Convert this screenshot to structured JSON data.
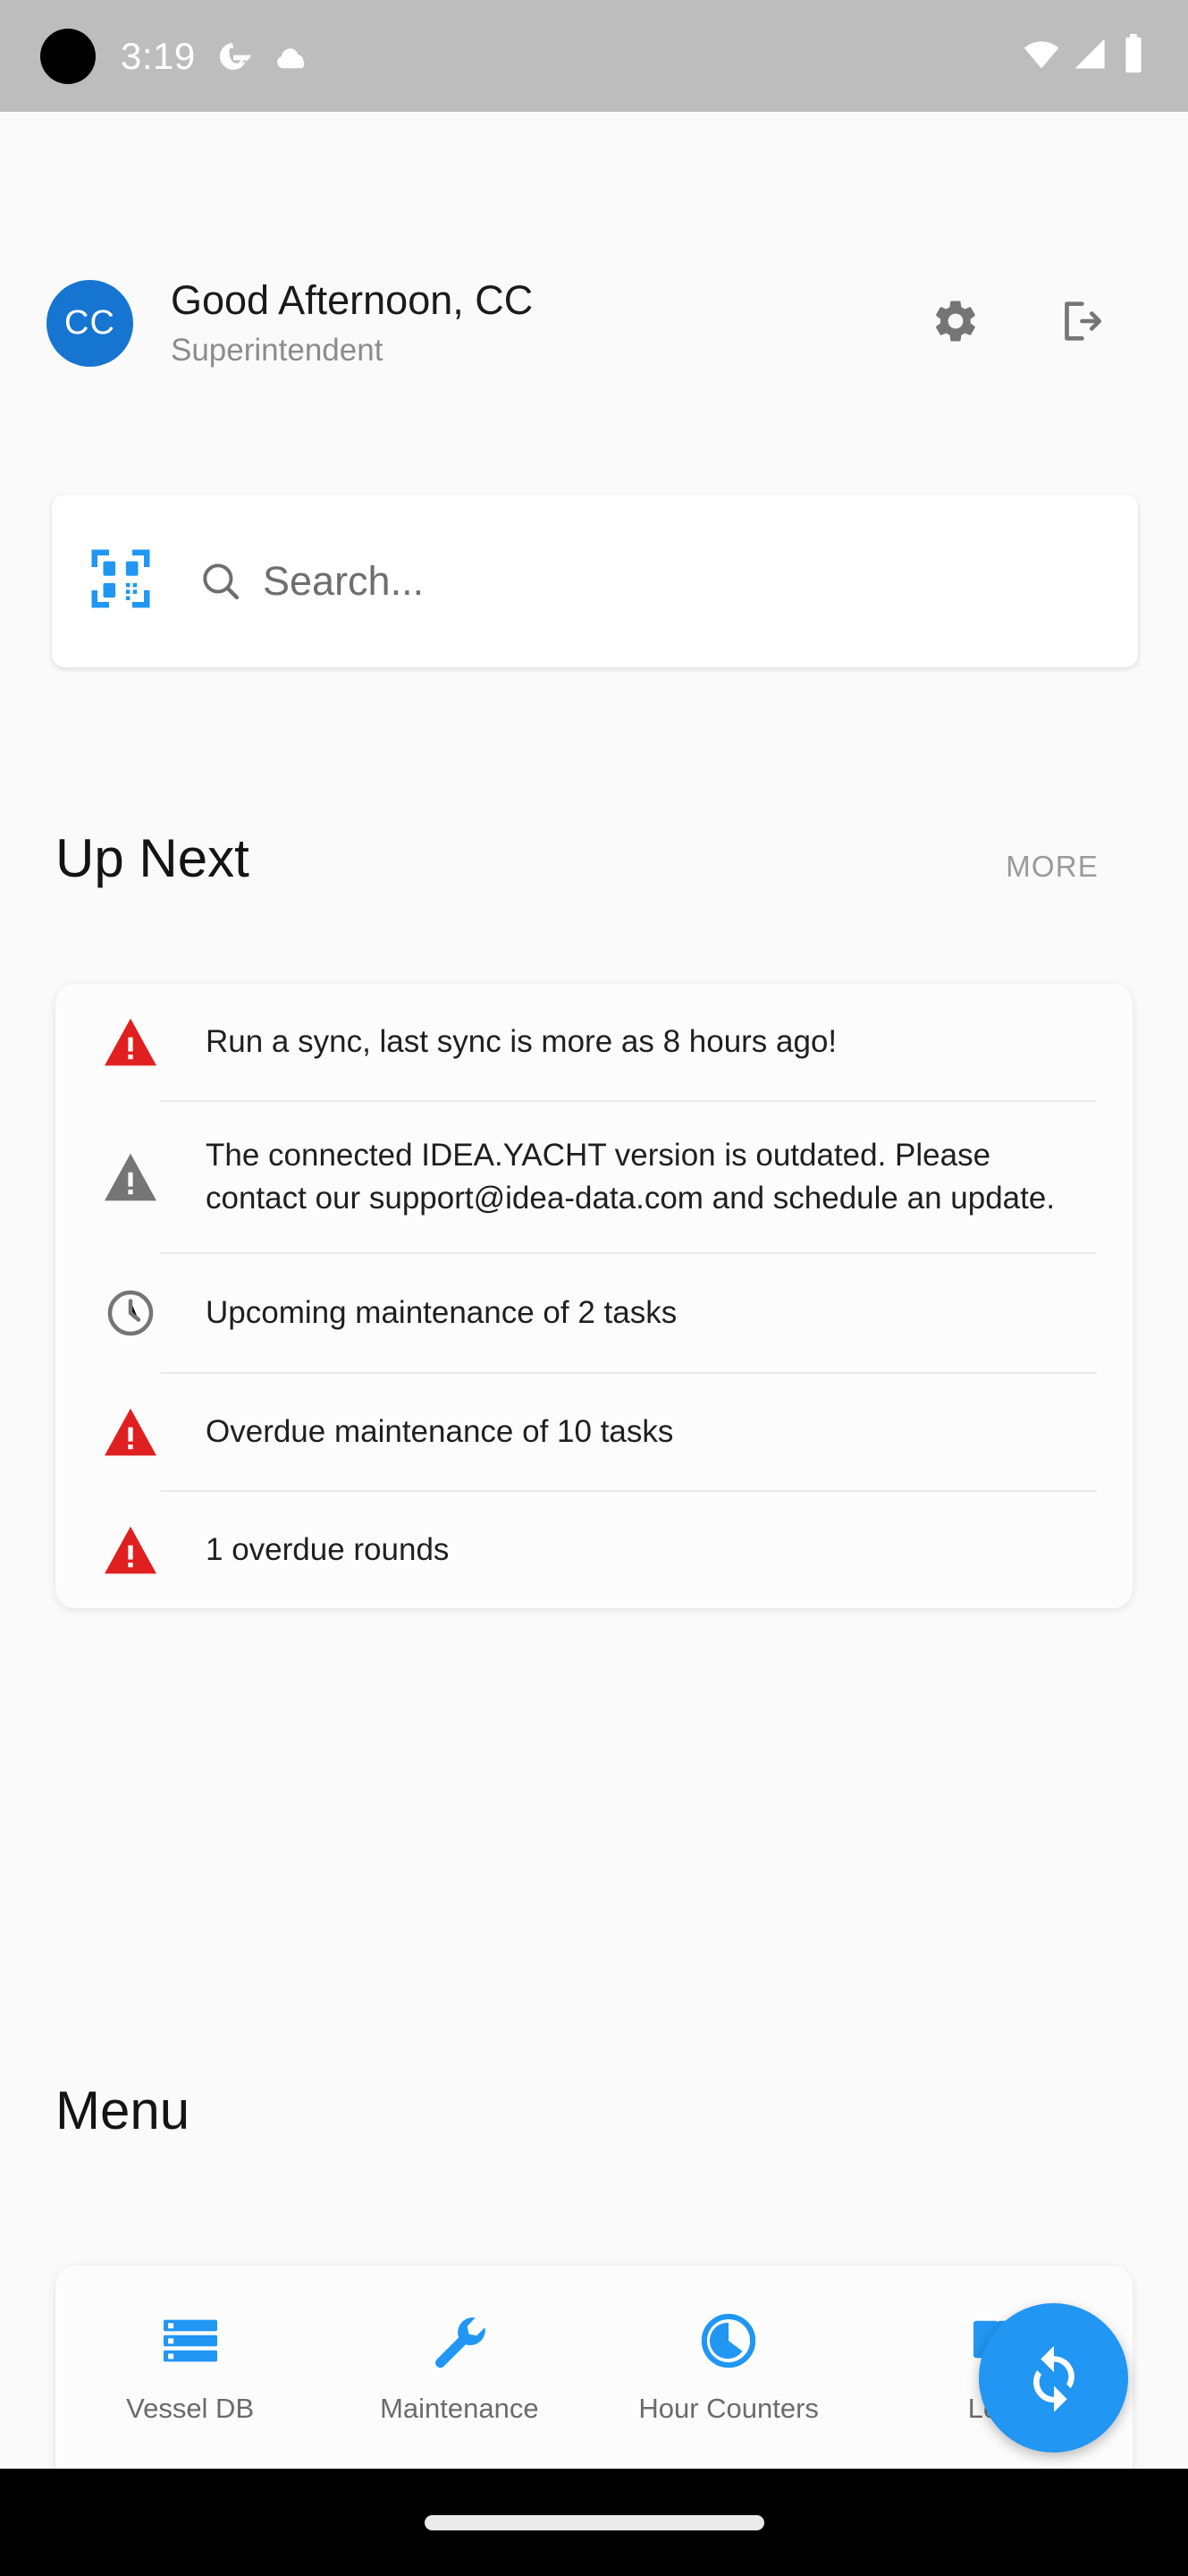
{
  "statusbar": {
    "time": "3:19",
    "icons_left": [
      "google-g-icon",
      "cloud-icon"
    ],
    "icons_right": [
      "wifi-icon",
      "signal-icon",
      "battery-icon"
    ],
    "background": "#bdbdbd"
  },
  "header": {
    "avatar_initials": "CC",
    "avatar_color": "#1675d1",
    "greeting": "Good Afternoon, CC",
    "role": "Superintendent",
    "settings_icon": "gear-icon",
    "logout_icon": "logout-icon"
  },
  "search": {
    "placeholder": "Search...",
    "value": "",
    "scan_icon": "qr-code-scanner-icon",
    "search_icon": "search-icon"
  },
  "up_next": {
    "title": "Up Next",
    "more_label": "MORE",
    "items": [
      {
        "icon": "warning-triangle-icon",
        "icon_color": "#e02020",
        "text": "Run a sync, last sync is more as 8 hours ago!"
      },
      {
        "icon": "warning-triangle-icon",
        "icon_color": "#757575",
        "text": "The connected IDEA.YACHT version is outdated. Please contact our support@idea-data.com and schedule an update."
      },
      {
        "icon": "clock-icon",
        "icon_color": "#757575",
        "text": "Upcoming maintenance of 2 tasks"
      },
      {
        "icon": "warning-triangle-icon",
        "icon_color": "#e02020",
        "text": "Overdue maintenance of 10 tasks"
      },
      {
        "icon": "warning-triangle-icon",
        "icon_color": "#e02020",
        "text": "1 overdue rounds"
      }
    ]
  },
  "menu": {
    "title": "Menu"
  },
  "bottom_nav": {
    "accent_color": "#2196f3",
    "items": [
      {
        "label": "Vessel DB",
        "icon": "storage-database-icon"
      },
      {
        "label": "Maintenance",
        "icon": "wrench-icon"
      },
      {
        "label": "Hour Counters",
        "icon": "timer-pie-icon"
      },
      {
        "label": "Logs",
        "icon": "book-logs-icon"
      }
    ]
  },
  "fab": {
    "icon": "sync-icon",
    "color": "#2196f3"
  }
}
